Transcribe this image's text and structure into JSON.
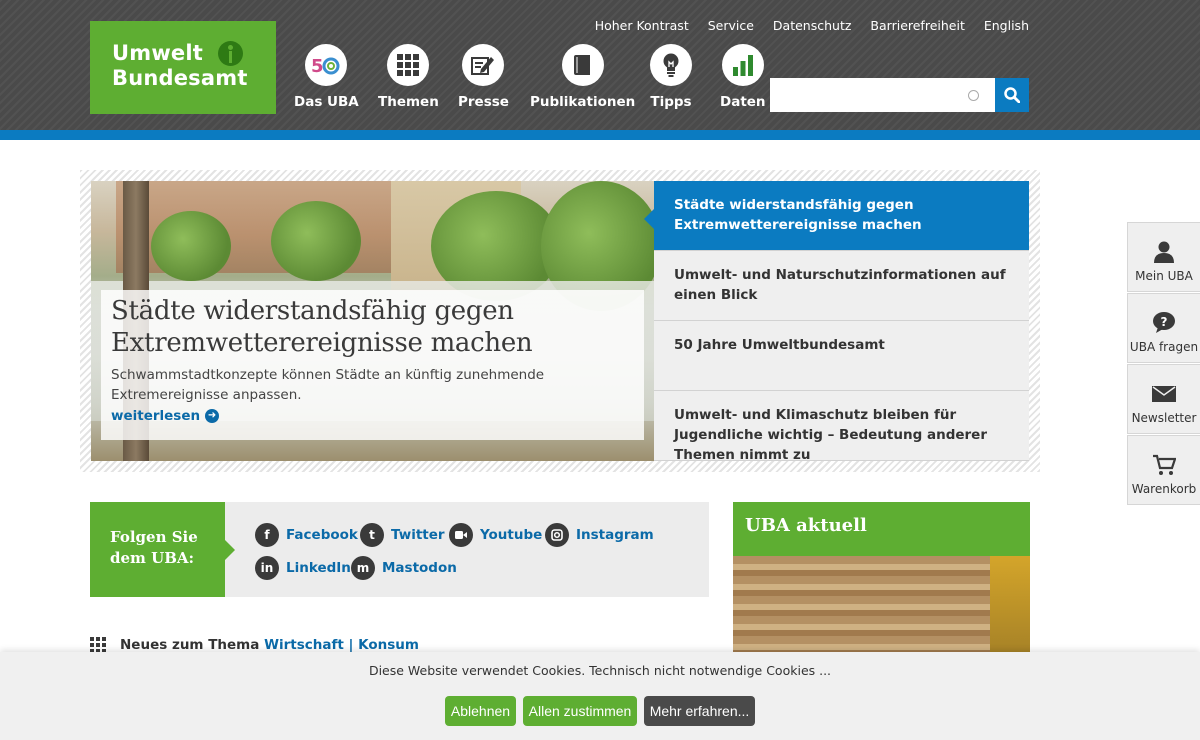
{
  "logo": {
    "line1": "Umwelt",
    "line2": "Bundesamt"
  },
  "topnav": [
    "Hoher Kontrast",
    "Service",
    "Datenschutz",
    "Barrierefreiheit",
    "English"
  ],
  "mainnav": [
    {
      "label": "Das UBA",
      "icon": "uba-50-icon"
    },
    {
      "label": "Themen",
      "icon": "grid-icon"
    },
    {
      "label": "Presse",
      "icon": "edit-icon"
    },
    {
      "label": "Publikationen",
      "icon": "book-icon"
    },
    {
      "label": "Tipps",
      "icon": "lightbulb-icon"
    },
    {
      "label": "Daten",
      "icon": "bar-chart-icon"
    }
  ],
  "search": {
    "placeholder": ""
  },
  "slider": {
    "title": "Städte widerstandsfähig gegen Extremwetterereignisse machen",
    "text": "Schwammstadtkonzepte können Städte an künftig zunehmende Extremereignisse anpassen.",
    "more": "weiterlesen",
    "items": [
      "Städte widerstandsfähig gegen Extremwetterereignisse machen",
      "Umwelt- und Naturschutzinformationen auf einen Blick",
      "50 Jahre Umweltbundesamt",
      "Umwelt- und Klimaschutz bleiben für Jugendliche wichtig – Bedeutung anderer Themen nimmt zu"
    ]
  },
  "follow": {
    "heading": "Folgen Sie dem UBA:",
    "links": [
      "Facebook",
      "Twitter",
      "Youtube",
      "Instagram",
      "LinkedIn",
      "Mastodon"
    ]
  },
  "aktuell": {
    "title": "UBA aktuell"
  },
  "neues": {
    "prefix": "Neues zum Thema",
    "link1": "Wirtschaft",
    "sep": "|",
    "link2": "Konsum"
  },
  "sidetools": [
    "Mein UBA",
    "UBA fragen",
    "Newsletter",
    "Warenkorb"
  ],
  "cookie": {
    "text": "Diese Website verwendet Cookies. Technisch nicht notwendige Cookies ...",
    "decline": "Ablehnen",
    "accept": "Allen zustimmen",
    "more": "Mehr erfahren..."
  },
  "colors": {
    "green": "#5eae32",
    "blue": "#0b7bc1",
    "dark": "#4a4a4a"
  }
}
